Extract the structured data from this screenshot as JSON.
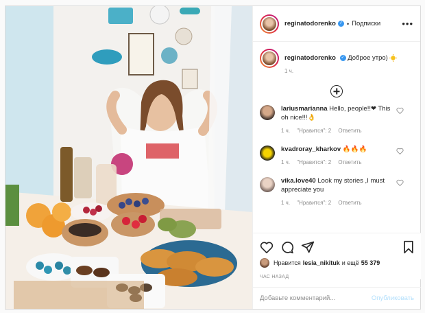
{
  "header": {
    "username": "reginatodorenko",
    "follow_label": "Подписки",
    "more_label": "•••"
  },
  "caption": {
    "username": "reginatodorenko",
    "text": "Доброе утро)",
    "time": "1 ч."
  },
  "comments": [
    {
      "username": "lariusmarianna",
      "text": "Hello, people!!❤ This oh nice!!!👌",
      "time": "1 ч.",
      "likes": "\"Нравится\": 2",
      "reply": "Ответить"
    },
    {
      "username": "kvadroray_kharkov",
      "text": "🔥🔥🔥",
      "time": "1 ч.",
      "likes": "\"Нравится\": 2",
      "reply": "Ответить"
    },
    {
      "username": "vika.love40",
      "text": "Look my stories ,I must appreciate you",
      "time": "1 ч.",
      "likes": "\"Нравится\": 2",
      "reply": "Ответить"
    }
  ],
  "likes": {
    "prefix": "Нравится",
    "user": "lesia_nikituk",
    "suffix": "и ещё",
    "count": "55 379"
  },
  "time_ago": "ЧАС НАЗАД",
  "add_comment": {
    "placeholder": "Добавьте комментарий...",
    "publish_label": "Опубликовать"
  },
  "icons": [
    "heart-icon",
    "comment-icon",
    "share-icon",
    "bookmark-icon",
    "verified-icon",
    "add-comments-icon"
  ]
}
